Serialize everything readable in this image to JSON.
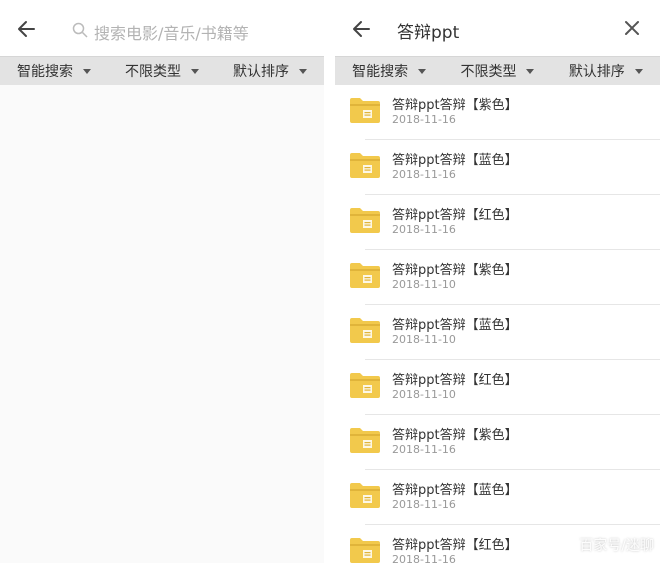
{
  "left": {
    "search_placeholder": "搜索电影/音乐/书籍等",
    "filters": [
      "智能搜索",
      "不限类型",
      "默认排序"
    ]
  },
  "right": {
    "query": "答辩ppt",
    "filters": [
      "智能搜索",
      "不限类型",
      "默认排序"
    ],
    "results": [
      {
        "name": "答辩ppt答辩【紫色】",
        "date": "2018-11-16"
      },
      {
        "name": "答辩ppt答辩【蓝色】",
        "date": "2018-11-16"
      },
      {
        "name": "答辩ppt答辩【红色】",
        "date": "2018-11-16"
      },
      {
        "name": "答辩ppt答辩【紫色】",
        "date": "2018-11-10"
      },
      {
        "name": "答辩ppt答辩【蓝色】",
        "date": "2018-11-10"
      },
      {
        "name": "答辩ppt答辩【红色】",
        "date": "2018-11-10"
      },
      {
        "name": "答辩ppt答辩【紫色】",
        "date": "2018-11-16"
      },
      {
        "name": "答辩ppt答辩【蓝色】",
        "date": "2018-11-16"
      },
      {
        "name": "答辩ppt答辩【红色】",
        "date": "2018-11-16"
      }
    ]
  },
  "watermark": "百家号/迷聊",
  "colors": {
    "folder": "#f2c94c",
    "folder_dark": "#e0b43a",
    "filter_bg": "#e3e3e3"
  }
}
